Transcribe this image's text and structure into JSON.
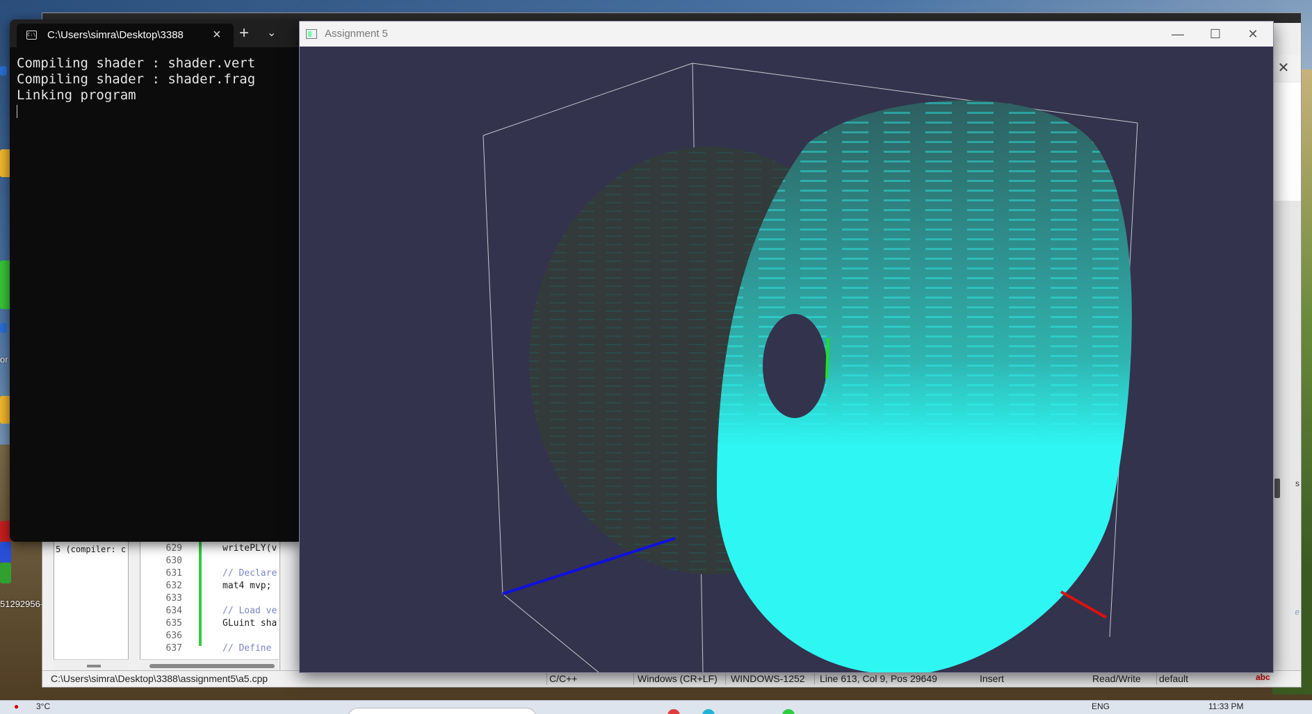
{
  "desktop": {
    "left_labels": [
      "or",
      "51292956-"
    ]
  },
  "terminal": {
    "tab_title": "C:\\Users\\simra\\Desktop\\3388",
    "lines": [
      "Compiling shader : shader.vert",
      "Compiling shader : shader.frag",
      "Linking program"
    ]
  },
  "gl_window": {
    "title": "Assignment 5"
  },
  "editor": {
    "compiler_text": "5 (compiler: c",
    "code_lines": [
      {
        "num": "629",
        "text": "writePLY(v",
        "comment": false
      },
      {
        "num": "630",
        "text": "",
        "comment": false
      },
      {
        "num": "631",
        "text": "// Declare",
        "comment": true
      },
      {
        "num": "632",
        "text": "mat4 mvp;",
        "comment": false
      },
      {
        "num": "633",
        "text": "",
        "comment": false
      },
      {
        "num": "634",
        "text": "// Load ve",
        "comment": true
      },
      {
        "num": "635",
        "text": "GLuint sha",
        "comment": false
      },
      {
        "num": "636",
        "text": "",
        "comment": false
      },
      {
        "num": "637",
        "text": "// Define",
        "comment": true
      }
    ],
    "right_link_text": "e",
    "right_s_text": "s",
    "status": {
      "file_path": "C:\\Users\\simra\\Desktop\\3388\\assignment5\\a5.cpp",
      "language": "C/C++",
      "line_endings": "Windows (CR+LF)",
      "encoding": "WINDOWS-1252",
      "position": "Line 613, Col 9, Pos 29649",
      "mode": "Insert",
      "access": "Read/Write",
      "scheme": "default"
    }
  },
  "taskbar": {
    "weather": "3°C",
    "lang": "ENG",
    "clock": "11:33 PM"
  },
  "colors": {
    "gl_background": "#33334d",
    "voxel_front": "#2ef6f2",
    "voxel_dark": "#333a3a",
    "axis_x": "#e01010",
    "axis_y": "#20e020",
    "axis_z": "#1010e0"
  }
}
